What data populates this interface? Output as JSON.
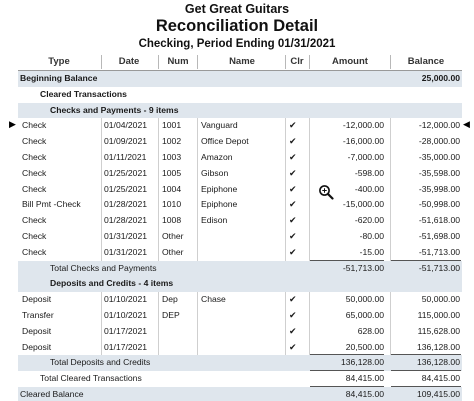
{
  "report": {
    "company": "Get Great Guitars",
    "title": "Reconciliation Detail",
    "subtitle": "Checking, Period Ending 01/31/2021"
  },
  "columns": [
    "Type",
    "Date",
    "Num",
    "Name",
    "Clr",
    "Amount",
    "Balance"
  ],
  "beginning_balance": {
    "label": "Beginning Balance",
    "balance": "25,000.00"
  },
  "cleared_label": "Cleared Transactions",
  "checks": {
    "heading": "Checks and Payments - 9 items",
    "rows": [
      {
        "type": "Check",
        "date": "01/04/2021",
        "num": "1001",
        "name": "Vanguard",
        "amount": "-12,000.00",
        "balance": "-12,000.00"
      },
      {
        "type": "Check",
        "date": "01/09/2021",
        "num": "1002",
        "name": "Office Depot",
        "amount": "-16,000.00",
        "balance": "-28,000.00"
      },
      {
        "type": "Check",
        "date": "01/11/2021",
        "num": "1003",
        "name": "Amazon",
        "amount": "-7,000.00",
        "balance": "-35,000.00"
      },
      {
        "type": "Check",
        "date": "01/25/2021",
        "num": "1005",
        "name": "Gibson",
        "amount": "-598.00",
        "balance": "-35,598.00"
      },
      {
        "type": "Check",
        "date": "01/25/2021",
        "num": "1004",
        "name": "Epiphone",
        "amount": "-400.00",
        "balance": "-35,998.00"
      },
      {
        "type": "Bill Pmt -Check",
        "date": "01/28/2021",
        "num": "1010",
        "name": "Epiphone",
        "amount": "-15,000.00",
        "balance": "-50,998.00"
      },
      {
        "type": "Check",
        "date": "01/28/2021",
        "num": "1008",
        "name": "Edison",
        "amount": "-620.00",
        "balance": "-51,618.00"
      },
      {
        "type": "Check",
        "date": "01/31/2021",
        "num": "Other",
        "name": "",
        "amount": "-80.00",
        "balance": "-51,698.00"
      },
      {
        "type": "Check",
        "date": "01/31/2021",
        "num": "Other",
        "name": "",
        "amount": "-15.00",
        "balance": "-51,713.00"
      }
    ],
    "total_label": "Total Checks and Payments",
    "total_amount": "-51,713.00",
    "total_balance": "-51,713.00"
  },
  "deposits": {
    "heading": "Deposits and Credits - 4 items",
    "rows": [
      {
        "type": "Deposit",
        "date": "01/10/2021",
        "num": "Dep",
        "name": "Chase",
        "amount": "50,000.00",
        "balance": "50,000.00"
      },
      {
        "type": "Transfer",
        "date": "01/10/2021",
        "num": "DEP",
        "name": "",
        "amount": "65,000.00",
        "balance": "115,000.00"
      },
      {
        "type": "Deposit",
        "date": "01/17/2021",
        "num": "",
        "name": "",
        "amount": "628.00",
        "balance": "115,628.00"
      },
      {
        "type": "Deposit",
        "date": "01/17/2021",
        "num": "",
        "name": "",
        "amount": "20,500.00",
        "balance": "136,128.00"
      }
    ],
    "total_label": "Total Deposits and Credits",
    "total_amount": "136,128.00",
    "total_balance": "136,128.00"
  },
  "total_cleared": {
    "label": "Total Cleared Transactions",
    "amount": "84,415.00",
    "balance": "84,415.00"
  },
  "cleared_balance": {
    "label": "Cleared Balance",
    "amount": "84,415.00",
    "balance": "109,415.00"
  },
  "check_glyph": "✔",
  "icons": {
    "row_pointer_left": "pointer-right-icon",
    "row_pointer_right": "pointer-left-icon",
    "zoom": "zoom-icon"
  }
}
